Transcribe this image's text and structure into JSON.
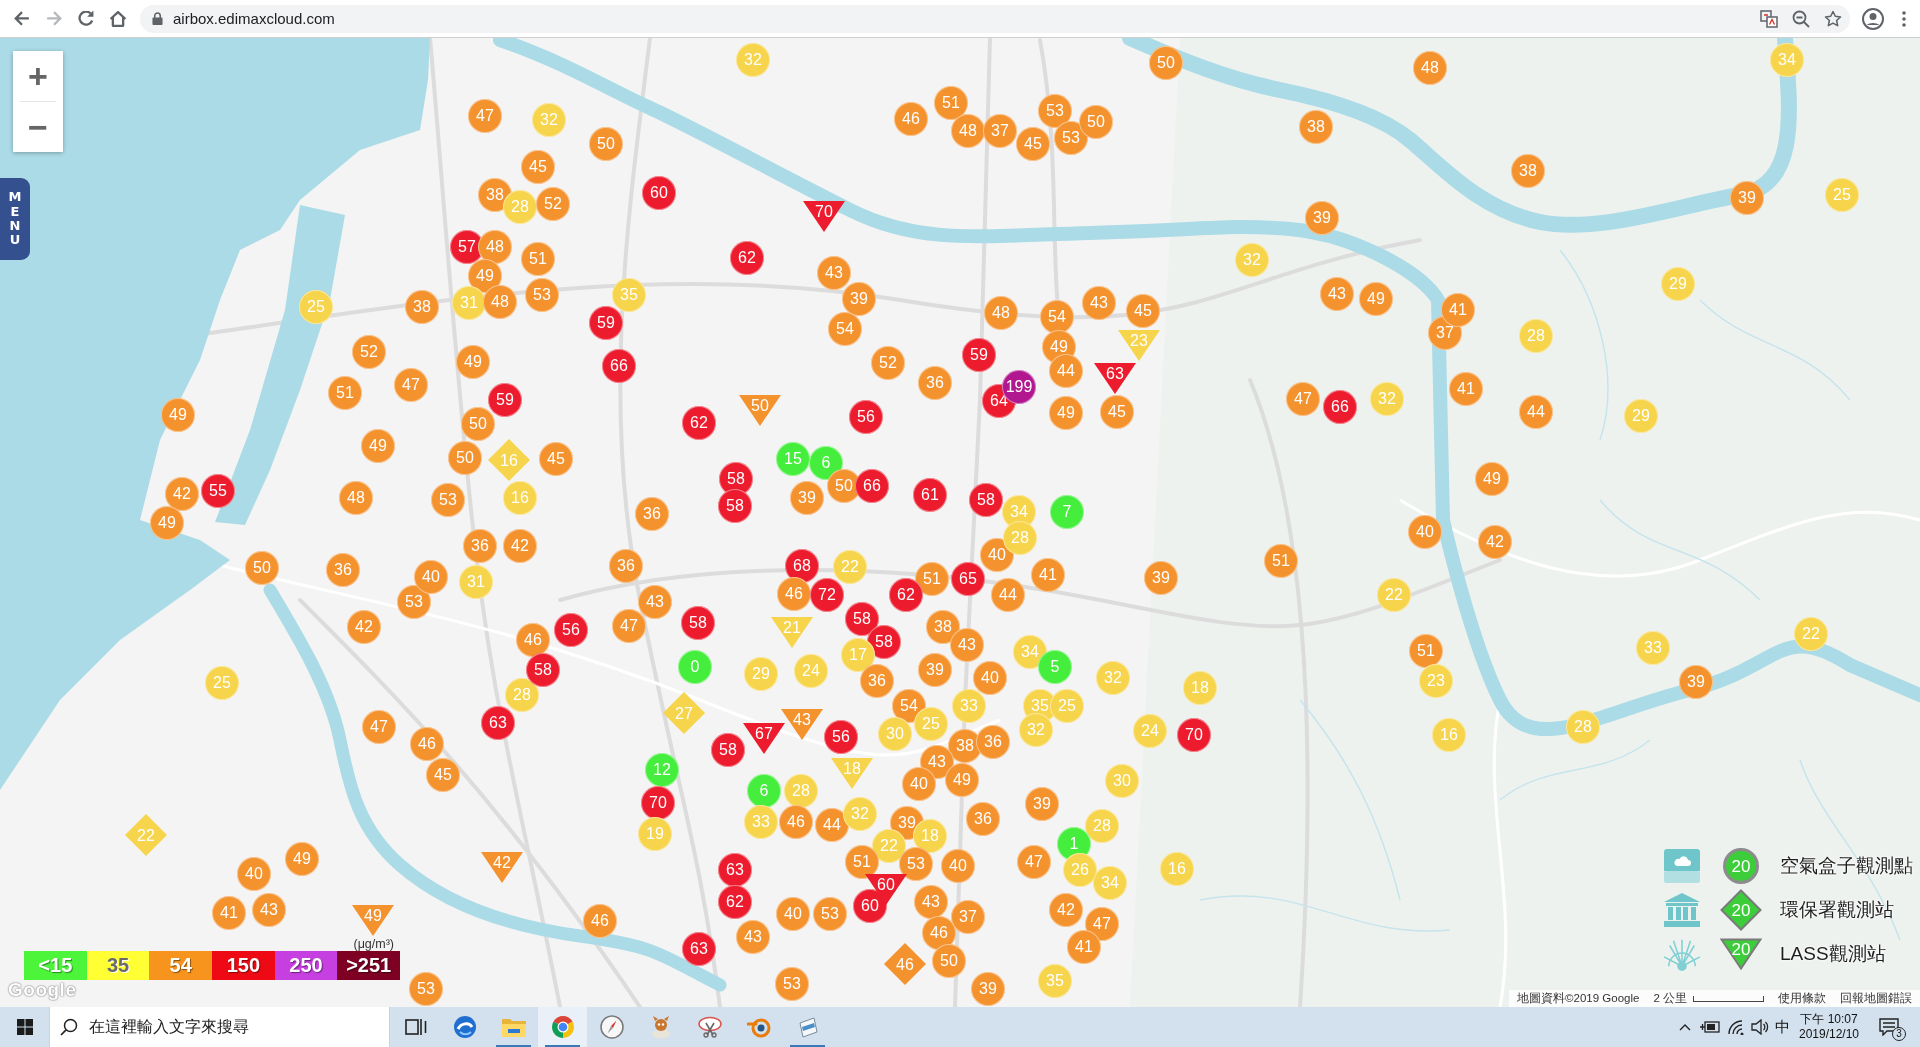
{
  "browser": {
    "nav": [
      {
        "kind": "back",
        "disabled": false
      },
      {
        "kind": "forward",
        "disabled": true
      },
      {
        "kind": "reload",
        "disabled": false
      },
      {
        "kind": "home",
        "disabled": false
      }
    ],
    "url": "airbox.edimaxcloud.com"
  },
  "map": {
    "zoom_controls": [
      "+",
      "−"
    ],
    "menu_tab": "MENU",
    "markers": [
      {
        "kind": "airbox",
        "value": "32",
        "color": "#f6d44b"
      },
      {
        "kind": "airbox",
        "value": "50",
        "color": "#f4922e"
      },
      {
        "kind": "airbox",
        "value": "48",
        "color": "#f4922e"
      },
      {
        "kind": "airbox",
        "value": "34",
        "color": "#f6d44b"
      },
      {
        "kind": "airbox",
        "value": "47",
        "color": "#f4922e"
      },
      {
        "kind": "airbox",
        "value": "32",
        "color": "#f6d44b"
      },
      {
        "kind": "airbox",
        "value": "46",
        "color": "#f4922e"
      },
      {
        "kind": "airbox",
        "value": "51",
        "color": "#f4922e"
      },
      {
        "kind": "airbox",
        "value": "53",
        "color": "#f4922e"
      },
      {
        "kind": "airbox",
        "value": "48",
        "color": "#f4922e"
      },
      {
        "kind": "airbox",
        "value": "37",
        "color": "#f4922e"
      },
      {
        "kind": "airbox",
        "value": "53",
        "color": "#f4922e"
      },
      {
        "kind": "airbox",
        "value": "50",
        "color": "#f4922e"
      },
      {
        "kind": "airbox",
        "value": "38",
        "color": "#f4922e"
      },
      {
        "kind": "airbox",
        "value": "50",
        "color": "#f4922e"
      },
      {
        "kind": "airbox",
        "value": "45",
        "color": "#f4922e"
      },
      {
        "kind": "airbox",
        "value": "45",
        "color": "#f4922e"
      },
      {
        "kind": "airbox",
        "value": "38",
        "color": "#f4922e"
      },
      {
        "kind": "airbox",
        "value": "38",
        "color": "#f4922e"
      },
      {
        "kind": "airbox",
        "value": "28",
        "color": "#f6d44b"
      },
      {
        "kind": "airbox",
        "value": "52",
        "color": "#f4922e"
      },
      {
        "kind": "airbox",
        "value": "60",
        "color": "#ec1b2d"
      },
      {
        "kind": "airbox",
        "value": "39",
        "color": "#f4922e"
      },
      {
        "kind": "airbox",
        "value": "25",
        "color": "#f6d44b"
      },
      {
        "kind": "lass",
        "value": "70",
        "color": "#ec1b2d"
      },
      {
        "kind": "airbox",
        "value": "39",
        "color": "#f4922e"
      },
      {
        "kind": "airbox",
        "value": "57",
        "color": "#ec1b2d"
      },
      {
        "kind": "airbox",
        "value": "48",
        "color": "#f4922e"
      },
      {
        "kind": "airbox",
        "value": "51",
        "color": "#f4922e"
      },
      {
        "kind": "airbox",
        "value": "62",
        "color": "#ec1b2d"
      },
      {
        "kind": "airbox",
        "value": "32",
        "color": "#f6d44b"
      },
      {
        "kind": "airbox",
        "value": "49",
        "color": "#f4922e"
      },
      {
        "kind": "airbox",
        "value": "43",
        "color": "#f4922e"
      },
      {
        "kind": "airbox",
        "value": "29",
        "color": "#f6d44b"
      },
      {
        "kind": "airbox",
        "value": "25",
        "color": "#f6d44b"
      },
      {
        "kind": "airbox",
        "value": "38",
        "color": "#f4922e"
      },
      {
        "kind": "airbox",
        "value": "31",
        "color": "#f6d44b"
      },
      {
        "kind": "airbox",
        "value": "48",
        "color": "#f4922e"
      },
      {
        "kind": "airbox",
        "value": "53",
        "color": "#f4922e"
      },
      {
        "kind": "airbox",
        "value": "35",
        "color": "#f6d44b"
      },
      {
        "kind": "airbox",
        "value": "39",
        "color": "#f4922e"
      },
      {
        "kind": "airbox",
        "value": "43",
        "color": "#f4922e"
      },
      {
        "kind": "airbox",
        "value": "45",
        "color": "#f4922e"
      },
      {
        "kind": "airbox",
        "value": "43",
        "color": "#f4922e"
      },
      {
        "kind": "airbox",
        "value": "49",
        "color": "#f4922e"
      },
      {
        "kind": "airbox",
        "value": "41",
        "color": "#f4922e"
      },
      {
        "kind": "airbox",
        "value": "59",
        "color": "#ec1b2d"
      },
      {
        "kind": "airbox",
        "value": "54",
        "color": "#f4922e"
      },
      {
        "kind": "airbox",
        "value": "48",
        "color": "#f4922e"
      },
      {
        "kind": "airbox",
        "value": "54",
        "color": "#f4922e"
      },
      {
        "kind": "airbox",
        "value": "49",
        "color": "#f4922e"
      },
      {
        "kind": "lass",
        "value": "23",
        "color": "#f6d44b"
      },
      {
        "kind": "airbox",
        "value": "37",
        "color": "#f4922e"
      },
      {
        "kind": "airbox",
        "value": "28",
        "color": "#f6d44b"
      },
      {
        "kind": "airbox",
        "value": "52",
        "color": "#f4922e"
      },
      {
        "kind": "airbox",
        "value": "49",
        "color": "#f4922e"
      },
      {
        "kind": "airbox",
        "value": "66",
        "color": "#ec1b2d"
      },
      {
        "kind": "airbox",
        "value": "52",
        "color": "#f4922e"
      },
      {
        "kind": "airbox",
        "value": "59",
        "color": "#ec1b2d"
      },
      {
        "kind": "airbox",
        "value": "47",
        "color": "#f4922e"
      },
      {
        "kind": "airbox",
        "value": "36",
        "color": "#f4922e"
      },
      {
        "kind": "airbox",
        "value": "199",
        "color": "#b1178e"
      },
      {
        "kind": "airbox",
        "value": "44",
        "color": "#f4922e"
      },
      {
        "kind": "lass",
        "value": "63",
        "color": "#ec1b2d"
      },
      {
        "kind": "airbox",
        "value": "51",
        "color": "#f4922e"
      },
      {
        "kind": "airbox",
        "value": "59",
        "color": "#ec1b2d"
      },
      {
        "kind": "airbox",
        "value": "64",
        "color": "#ec1b2d"
      },
      {
        "kind": "airbox",
        "value": "47",
        "color": "#f4922e"
      },
      {
        "kind": "airbox",
        "value": "32",
        "color": "#f6d44b"
      },
      {
        "kind": "airbox",
        "value": "41",
        "color": "#f4922e"
      },
      {
        "kind": "airbox",
        "value": "49",
        "color": "#f4922e"
      },
      {
        "kind": "airbox",
        "value": "50",
        "color": "#f4922e"
      },
      {
        "kind": "airbox",
        "value": "62",
        "color": "#ec1b2d"
      },
      {
        "kind": "lass",
        "value": "50",
        "color": "#f4922e"
      },
      {
        "kind": "airbox",
        "value": "56",
        "color": "#ec1b2d"
      },
      {
        "kind": "airbox",
        "value": "49",
        "color": "#f4922e"
      },
      {
        "kind": "airbox",
        "value": "45",
        "color": "#f4922e"
      },
      {
        "kind": "airbox",
        "value": "66",
        "color": "#ec1b2d"
      },
      {
        "kind": "airbox",
        "value": "44",
        "color": "#f4922e"
      },
      {
        "kind": "airbox",
        "value": "29",
        "color": "#f6d44b"
      },
      {
        "kind": "airbox",
        "value": "49",
        "color": "#f4922e"
      },
      {
        "kind": "airbox",
        "value": "50",
        "color": "#f4922e"
      },
      {
        "kind": "epa",
        "value": "16",
        "color": "#f6d44b"
      },
      {
        "kind": "airbox",
        "value": "45",
        "color": "#f4922e"
      },
      {
        "kind": "airbox",
        "value": "15",
        "color": "#45ee3c"
      },
      {
        "kind": "airbox",
        "value": "6",
        "color": "#45ee3c"
      },
      {
        "kind": "airbox",
        "value": "42",
        "color": "#f4922e"
      },
      {
        "kind": "airbox",
        "value": "55",
        "color": "#ec1b2d"
      },
      {
        "kind": "airbox",
        "value": "58",
        "color": "#ec1b2d"
      },
      {
        "kind": "airbox",
        "value": "50",
        "color": "#f4922e"
      },
      {
        "kind": "airbox",
        "value": "66",
        "color": "#ec1b2d"
      },
      {
        "kind": "airbox",
        "value": "61",
        "color": "#ec1b2d"
      },
      {
        "kind": "airbox",
        "value": "49",
        "color": "#f4922e"
      },
      {
        "kind": "airbox",
        "value": "48",
        "color": "#f4922e"
      },
      {
        "kind": "airbox",
        "value": "53",
        "color": "#f4922e"
      },
      {
        "kind": "airbox",
        "value": "16",
        "color": "#f6d44b"
      },
      {
        "kind": "airbox",
        "value": "36",
        "color": "#f4922e"
      },
      {
        "kind": "airbox",
        "value": "58",
        "color": "#ec1b2d"
      },
      {
        "kind": "airbox",
        "value": "39",
        "color": "#f4922e"
      },
      {
        "kind": "airbox",
        "value": "58",
        "color": "#ec1b2d"
      },
      {
        "kind": "airbox",
        "value": "34",
        "color": "#f6d44b"
      },
      {
        "kind": "airbox",
        "value": "7",
        "color": "#45ee3c"
      },
      {
        "kind": "airbox",
        "value": "49",
        "color": "#f4922e"
      },
      {
        "kind": "airbox",
        "value": "28",
        "color": "#f6d44b"
      },
      {
        "kind": "airbox",
        "value": "40",
        "color": "#f4922e"
      },
      {
        "kind": "airbox",
        "value": "36",
        "color": "#f4922e"
      },
      {
        "kind": "airbox",
        "value": "42",
        "color": "#f4922e"
      },
      {
        "kind": "airbox",
        "value": "40",
        "color": "#f4922e"
      },
      {
        "kind": "airbox",
        "value": "42",
        "color": "#f4922e"
      },
      {
        "kind": "airbox",
        "value": "50",
        "color": "#f4922e"
      },
      {
        "kind": "airbox",
        "value": "36",
        "color": "#f4922e"
      },
      {
        "kind": "airbox",
        "value": "40",
        "color": "#f4922e"
      },
      {
        "kind": "airbox",
        "value": "36",
        "color": "#f4922e"
      },
      {
        "kind": "airbox",
        "value": "68",
        "color": "#ec1b2d"
      },
      {
        "kind": "airbox",
        "value": "22",
        "color": "#f6d44b"
      },
      {
        "kind": "airbox",
        "value": "41",
        "color": "#f4922e"
      },
      {
        "kind": "airbox",
        "value": "39",
        "color": "#f4922e"
      },
      {
        "kind": "airbox",
        "value": "51",
        "color": "#f4922e"
      },
      {
        "kind": "airbox",
        "value": "31",
        "color": "#f6d44b"
      },
      {
        "kind": "airbox",
        "value": "46",
        "color": "#f4922e"
      },
      {
        "kind": "airbox",
        "value": "72",
        "color": "#ec1b2d"
      },
      {
        "kind": "airbox",
        "value": "62",
        "color": "#ec1b2d"
      },
      {
        "kind": "airbox",
        "value": "51",
        "color": "#f4922e"
      },
      {
        "kind": "airbox",
        "value": "65",
        "color": "#ec1b2d"
      },
      {
        "kind": "airbox",
        "value": "44",
        "color": "#f4922e"
      },
      {
        "kind": "airbox",
        "value": "22",
        "color": "#f6d44b"
      },
      {
        "kind": "airbox",
        "value": "53",
        "color": "#f4922e"
      },
      {
        "kind": "airbox",
        "value": "43",
        "color": "#f4922e"
      },
      {
        "kind": "airbox",
        "value": "58",
        "color": "#ec1b2d"
      },
      {
        "kind": "airbox",
        "value": "42",
        "color": "#f4922e"
      },
      {
        "kind": "airbox",
        "value": "46",
        "color": "#f4922e"
      },
      {
        "kind": "airbox",
        "value": "56",
        "color": "#ec1b2d"
      },
      {
        "kind": "airbox",
        "value": "47",
        "color": "#f4922e"
      },
      {
        "kind": "airbox",
        "value": "58",
        "color": "#ec1b2d"
      },
      {
        "kind": "lass",
        "value": "21",
        "color": "#f6d44b"
      },
      {
        "kind": "airbox",
        "value": "38",
        "color": "#f4922e"
      },
      {
        "kind": "airbox",
        "value": "22",
        "color": "#f6d44b"
      },
      {
        "kind": "airbox",
        "value": "17",
        "color": "#f6d44b"
      },
      {
        "kind": "airbox",
        "value": "58",
        "color": "#ec1b2d"
      },
      {
        "kind": "airbox",
        "value": "43",
        "color": "#f4922e"
      },
      {
        "kind": "airbox",
        "value": "34",
        "color": "#f6d44b"
      },
      {
        "kind": "airbox",
        "value": "51",
        "color": "#f4922e"
      },
      {
        "kind": "airbox",
        "value": "33",
        "color": "#f6d44b"
      },
      {
        "kind": "airbox",
        "value": "25",
        "color": "#f6d44b"
      },
      {
        "kind": "airbox",
        "value": "58",
        "color": "#ec1b2d"
      },
      {
        "kind": "airbox",
        "value": "0",
        "color": "#45ee3c"
      },
      {
        "kind": "airbox",
        "value": "29",
        "color": "#f6d44b"
      },
      {
        "kind": "airbox",
        "value": "24",
        "color": "#f6d44b"
      },
      {
        "kind": "airbox",
        "value": "36",
        "color": "#f4922e"
      },
      {
        "kind": "airbox",
        "value": "39",
        "color": "#f4922e"
      },
      {
        "kind": "airbox",
        "value": "40",
        "color": "#f4922e"
      },
      {
        "kind": "airbox",
        "value": "5",
        "color": "#45ee3c"
      },
      {
        "kind": "airbox",
        "value": "32",
        "color": "#f6d44b"
      },
      {
        "kind": "airbox",
        "value": "23",
        "color": "#f6d44b"
      },
      {
        "kind": "airbox",
        "value": "39",
        "color": "#f4922e"
      },
      {
        "kind": "airbox",
        "value": "28",
        "color": "#f6d44b"
      },
      {
        "kind": "airbox",
        "value": "18",
        "color": "#f6d44b"
      },
      {
        "kind": "airbox",
        "value": "63",
        "color": "#ec1b2d"
      },
      {
        "kind": "epa",
        "value": "27",
        "color": "#f6d44b"
      },
      {
        "kind": "airbox",
        "value": "54",
        "color": "#f4922e"
      },
      {
        "kind": "airbox",
        "value": "33",
        "color": "#f6d44b"
      },
      {
        "kind": "airbox",
        "value": "35",
        "color": "#f6d44b"
      },
      {
        "kind": "airbox",
        "value": "25",
        "color": "#f6d44b"
      },
      {
        "kind": "airbox",
        "value": "47",
        "color": "#f4922e"
      },
      {
        "kind": "lass",
        "value": "67",
        "color": "#ec1b2d"
      },
      {
        "kind": "lass",
        "value": "43",
        "color": "#f4922e"
      },
      {
        "kind": "airbox",
        "value": "56",
        "color": "#ec1b2d"
      },
      {
        "kind": "airbox",
        "value": "30",
        "color": "#f6d44b"
      },
      {
        "kind": "airbox",
        "value": "25",
        "color": "#f6d44b"
      },
      {
        "kind": "airbox",
        "value": "32",
        "color": "#f6d44b"
      },
      {
        "kind": "airbox",
        "value": "24",
        "color": "#f6d44b"
      },
      {
        "kind": "airbox",
        "value": "70",
        "color": "#ec1b2d"
      },
      {
        "kind": "airbox",
        "value": "16",
        "color": "#f6d44b"
      },
      {
        "kind": "airbox",
        "value": "28",
        "color": "#f6d44b"
      },
      {
        "kind": "airbox",
        "value": "46",
        "color": "#f4922e"
      },
      {
        "kind": "airbox",
        "value": "58",
        "color": "#ec1b2d"
      },
      {
        "kind": "airbox",
        "value": "38",
        "color": "#f4922e"
      },
      {
        "kind": "airbox",
        "value": "36",
        "color": "#f4922e"
      },
      {
        "kind": "airbox",
        "value": "45",
        "color": "#f4922e"
      },
      {
        "kind": "airbox",
        "value": "12",
        "color": "#45ee3c"
      },
      {
        "kind": "lass",
        "value": "18",
        "color": "#f6d44b"
      },
      {
        "kind": "airbox",
        "value": "43",
        "color": "#f4922e"
      },
      {
        "kind": "airbox",
        "value": "6",
        "color": "#45ee3c"
      },
      {
        "kind": "airbox",
        "value": "28",
        "color": "#f6d44b"
      },
      {
        "kind": "airbox",
        "value": "40",
        "color": "#f4922e"
      },
      {
        "kind": "airbox",
        "value": "49",
        "color": "#f4922e"
      },
      {
        "kind": "airbox",
        "value": "30",
        "color": "#f6d44b"
      },
      {
        "kind": "airbox",
        "value": "70",
        "color": "#ec1b2d"
      },
      {
        "kind": "airbox",
        "value": "32",
        "color": "#f6d44b"
      },
      {
        "kind": "airbox",
        "value": "36",
        "color": "#f4922e"
      },
      {
        "kind": "airbox",
        "value": "39",
        "color": "#f4922e"
      },
      {
        "kind": "epa",
        "value": "22",
        "color": "#f6d44b"
      },
      {
        "kind": "airbox",
        "value": "19",
        "color": "#f6d44b"
      },
      {
        "kind": "airbox",
        "value": "33",
        "color": "#f6d44b"
      },
      {
        "kind": "airbox",
        "value": "46",
        "color": "#f4922e"
      },
      {
        "kind": "airbox",
        "value": "44",
        "color": "#f4922e"
      },
      {
        "kind": "airbox",
        "value": "39",
        "color": "#f4922e"
      },
      {
        "kind": "airbox",
        "value": "18",
        "color": "#f6d44b"
      },
      {
        "kind": "airbox",
        "value": "28",
        "color": "#f6d44b"
      },
      {
        "kind": "airbox",
        "value": "49",
        "color": "#f4922e"
      },
      {
        "kind": "airbox",
        "value": "22",
        "color": "#f6d44b"
      },
      {
        "kind": "airbox",
        "value": "1",
        "color": "#45ee3c"
      },
      {
        "kind": "airbox",
        "value": "40",
        "color": "#f4922e"
      },
      {
        "kind": "lass",
        "value": "42",
        "color": "#f4922e"
      },
      {
        "kind": "airbox",
        "value": "63",
        "color": "#ec1b2d"
      },
      {
        "kind": "airbox",
        "value": "51",
        "color": "#f4922e"
      },
      {
        "kind": "airbox",
        "value": "53",
        "color": "#f4922e"
      },
      {
        "kind": "airbox",
        "value": "40",
        "color": "#f4922e"
      },
      {
        "kind": "airbox",
        "value": "47",
        "color": "#f4922e"
      },
      {
        "kind": "airbox",
        "value": "26",
        "color": "#f6d44b"
      },
      {
        "kind": "airbox",
        "value": "16",
        "color": "#f6d44b"
      },
      {
        "kind": "lass",
        "value": "60",
        "color": "#ec1b2d"
      },
      {
        "kind": "airbox",
        "value": "34",
        "color": "#f6d44b"
      },
      {
        "kind": "airbox",
        "value": "41",
        "color": "#f4922e"
      },
      {
        "kind": "airbox",
        "value": "43",
        "color": "#f4922e"
      },
      {
        "kind": "airbox",
        "value": "62",
        "color": "#ec1b2d"
      },
      {
        "kind": "airbox",
        "value": "40",
        "color": "#f4922e"
      },
      {
        "kind": "airbox",
        "value": "53",
        "color": "#f4922e"
      },
      {
        "kind": "airbox",
        "value": "60",
        "color": "#ec1b2d"
      },
      {
        "kind": "airbox",
        "value": "43",
        "color": "#f4922e"
      },
      {
        "kind": "airbox",
        "value": "37",
        "color": "#f4922e"
      },
      {
        "kind": "airbox",
        "value": "42",
        "color": "#f4922e"
      },
      {
        "kind": "lass",
        "value": "49",
        "color": "#f4922e"
      },
      {
        "kind": "airbox",
        "value": "46",
        "color": "#f4922e"
      },
      {
        "kind": "airbox",
        "value": "43",
        "color": "#f4922e"
      },
      {
        "kind": "airbox",
        "value": "46",
        "color": "#f4922e"
      },
      {
        "kind": "airbox",
        "value": "47",
        "color": "#f4922e"
      },
      {
        "kind": "airbox",
        "value": "63",
        "color": "#ec1b2d"
      },
      {
        "kind": "epa",
        "value": "46",
        "color": "#f4922e"
      },
      {
        "kind": "airbox",
        "value": "50",
        "color": "#f4922e"
      },
      {
        "kind": "airbox",
        "value": "41",
        "color": "#f4922e"
      },
      {
        "kind": "airbox",
        "value": "53",
        "color": "#f4922e"
      },
      {
        "kind": "airbox",
        "value": "53",
        "color": "#f4922e"
      },
      {
        "kind": "airbox",
        "value": "39",
        "color": "#f4922e"
      },
      {
        "kind": "airbox",
        "value": "35",
        "color": "#f6d44b"
      }
    ],
    "pm25_scale": {
      "unit": "(μg/m³)",
      "bands": [
        {
          "label": "<15",
          "color": "#4cf53a"
        },
        {
          "label": "35",
          "color": "#ffff33"
        },
        {
          "label": "54",
          "color": "#f7941e"
        },
        {
          "label": "150",
          "color": "#ee0a14"
        },
        {
          "label": "250",
          "color": "#c63fe0"
        },
        {
          "label": ">251",
          "color": "#7e0023"
        }
      ]
    },
    "provider_logo": "Google",
    "station_legend": [
      {
        "kind": "airbox",
        "value": "20",
        "label": "空氣盒子觀測點"
      },
      {
        "kind": "epa",
        "value": "20",
        "label": "環保署觀測站"
      },
      {
        "kind": "lass",
        "value": "20",
        "label": "LASS觀測站"
      }
    ],
    "attribution": {
      "map_data": "地圖資料©2019 Google",
      "scale": "2 公里",
      "terms": "使用條款",
      "report": "回報地圖錯誤"
    }
  },
  "taskbar": {
    "search": {
      "placeholder": "在這裡輸入文字來搜尋"
    },
    "apps": [
      {
        "kind": "task-view",
        "running": false,
        "selected": false
      },
      {
        "kind": "swirl",
        "running": false,
        "selected": false
      },
      {
        "kind": "folder",
        "running": true,
        "selected": false
      },
      {
        "kind": "segmented",
        "running": true,
        "selected": true
      },
      {
        "kind": "compass",
        "running": false,
        "selected": false
      },
      {
        "kind": "figurine",
        "running": false,
        "selected": false
      },
      {
        "kind": "scissors",
        "running": false,
        "selected": false
      },
      {
        "kind": "ring",
        "running": false,
        "selected": false
      },
      {
        "kind": "document",
        "running": true,
        "selected": false
      }
    ],
    "tray": {
      "input_method": "中",
      "time": "下午 10:07",
      "date": "2019/12/10",
      "notification_count": "3"
    }
  }
}
